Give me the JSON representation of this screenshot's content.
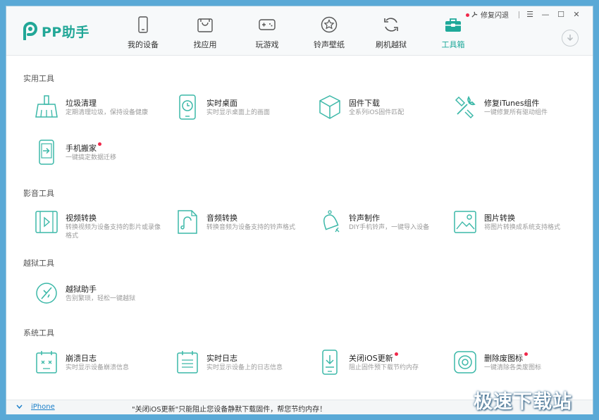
{
  "app": {
    "name": "PP助手"
  },
  "topbar": {
    "repair_label": "修复闪退",
    "menu_icon": "menu-icon",
    "minimize_icon": "minimize-icon",
    "maximize_icon": "maximize-icon",
    "close_icon": "close-icon"
  },
  "nav": [
    {
      "label": "我的设备",
      "icon": "phone-icon"
    },
    {
      "label": "找应用",
      "icon": "app-bag-icon"
    },
    {
      "label": "玩游戏",
      "icon": "gamepad-icon"
    },
    {
      "label": "铃声壁纸",
      "icon": "star-icon"
    },
    {
      "label": "刷机越狱",
      "icon": "refresh-icon"
    },
    {
      "label": "工具箱",
      "icon": "toolbox-icon",
      "active": true,
      "badge": true
    }
  ],
  "sections": [
    {
      "title": "实用工具",
      "tools": [
        {
          "name": "垃圾清理",
          "desc": "定期清理垃圾，保持设备健康",
          "icon": "broom-icon"
        },
        {
          "name": "实时桌面",
          "desc": "实时显示桌面上的画面",
          "icon": "clock-screen-icon"
        },
        {
          "name": "固件下载",
          "desc": "全系列iOS固件匹配",
          "icon": "cube-icon"
        },
        {
          "name": "修复iTunes组件",
          "desc": "一键修复所有驱动组件",
          "icon": "wrench-icon"
        },
        {
          "name": "手机搬家",
          "desc": "一键搞定数据迁移",
          "icon": "phone-transfer-icon",
          "badge": true
        }
      ]
    },
    {
      "title": "影音工具",
      "tools": [
        {
          "name": "视频转换",
          "desc": "转换视频为设备支持的影片或录像格式",
          "icon": "film-icon"
        },
        {
          "name": "音频转换",
          "desc": "转换音频为设备支持的铃声格式",
          "icon": "audio-file-icon"
        },
        {
          "name": "铃声制作",
          "desc": "DIY手机铃声，一键导入设备",
          "icon": "bell-icon"
        },
        {
          "name": "图片转换",
          "desc": "将图片转换成系统支持格式",
          "icon": "image-icon"
        }
      ]
    },
    {
      "title": "越狱工具",
      "tools": [
        {
          "name": "越狱助手",
          "desc": "告别繁琐，轻松一键越狱",
          "icon": "jailbreak-icon"
        }
      ]
    },
    {
      "title": "系统工具",
      "tools": [
        {
          "name": "崩溃日志",
          "desc": "实时显示设备崩溃信息",
          "icon": "crash-log-icon"
        },
        {
          "name": "实时日志",
          "desc": "实时显示设备上的日志信息",
          "icon": "log-icon"
        },
        {
          "name": "关闭iOS更新",
          "desc": "阻止固件预下载节约内存",
          "icon": "block-update-icon",
          "badge": true
        },
        {
          "name": "删除废图标",
          "desc": "一键清除各类废图标",
          "icon": "delete-icon",
          "badge": true
        }
      ]
    }
  ],
  "statusbar": {
    "device": "iPhone",
    "message": "\"关闭iOS更新\"只能阻止您设备静默下载固件，帮您节约内存！"
  },
  "watermark": "极速下载站",
  "colors": {
    "accent": "#22a797",
    "badge": "#f0284a",
    "link": "#1a7fc9"
  }
}
